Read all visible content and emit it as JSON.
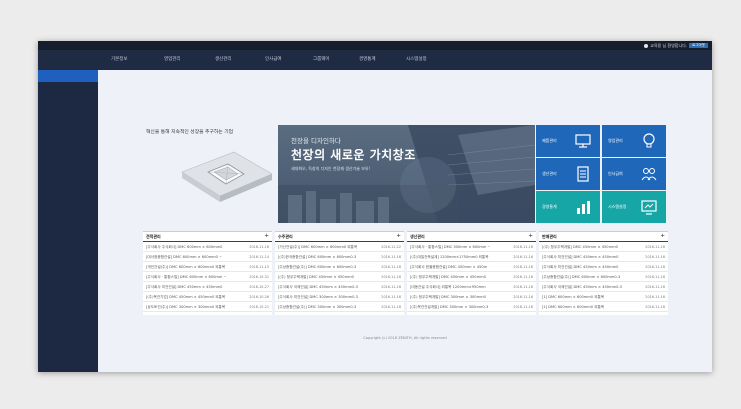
{
  "header": {
    "user_text": "교육용 님 환영합니다.",
    "logout_label": "로그아웃"
  },
  "nav": {
    "items": [
      "기본정보",
      "영업관리",
      "생산관리",
      "인사급여",
      "그룹웨어",
      "경영통계",
      "시스템설정"
    ]
  },
  "hero": {
    "slogan": "혁신을 통해 지속적인 성장을 추구하는 기업"
  },
  "banner": {
    "subtitle": "천장을 디자인하다",
    "title": "천장의 새로운 가치창조",
    "description": "세대화오, 독창의 디자인 천장재 생산기술 보유!"
  },
  "tiles": [
    {
      "label": "제품관리",
      "icon": "monitor-icon",
      "color": "#1f67b8"
    },
    {
      "label": "영업관리",
      "icon": "bulb-icon",
      "color": "#1f67b8"
    },
    {
      "label": "생산관리",
      "icon": "document-icon",
      "color": "#1f67b8"
    },
    {
      "label": "인사급여",
      "icon": "people-icon",
      "color": "#1f67b8"
    },
    {
      "label": "경영통계",
      "icon": "chart-icon",
      "color": "#17a6a6"
    },
    {
      "label": "시스템설정",
      "icon": "display-icon",
      "color": "#17a6a6"
    }
  ],
  "panels": [
    {
      "title": "견적관리",
      "rows": [
        {
          "text": "[주식회사 주식회사] DMC 600mm × 600mm0",
          "date": "2016-11-16"
        },
        {
          "text": "[대서정종합건설] DMC 600mm × 600mm0 ~",
          "date": "2016-11-14"
        },
        {
          "text": "[개인건설(주)] DMC 600mm × 600mm0 외통목",
          "date": "2016-11-15"
        },
        {
          "text": "[주식회사 · 통합스틸] DMC 600mm × 600mm ~",
          "date": "2016-10-31"
        },
        {
          "text": "[주식회사 미건건설] DMC 450mm × 450mm0",
          "date": "2016-10-27"
        },
        {
          "text": "[(주)목건기업] DMC 450mm × 450mm0 외통목",
          "date": "2016-10-26"
        },
        {
          "text": "[상도토건(주)] DMC 300mm × 300mm0 외통목",
          "date": "2016-10-21"
        }
      ]
    },
    {
      "title": "수주관리",
      "rows": [
        {
          "text": "[거산건설(주)] DMC 600mm × 600mm0 외통목",
          "date": "2016-11-22"
        },
        {
          "text": "[(주)한국종합건설] DMC 600mm × 600mm0-3",
          "date": "2016-11-16"
        },
        {
          "text": "[주상종합건설(주)] DMC 600mm × 600mm0-3",
          "date": "2016-11-16"
        },
        {
          "text": "[(주) 청우주택개발] DMC 450mm × 450mm0",
          "date": "2016-11-16"
        },
        {
          "text": "[주식회사 국제건설] DMC 450mm × 450mm0-3",
          "date": "2016-11-16"
        },
        {
          "text": "[주식회사 미건건설] DMC 300mm × 300mm0-3",
          "date": "2016-11-16"
        },
        {
          "text": "[주상종합건설(주)] DMC 300mm × 300mm0-3",
          "date": "2016-11-16"
        }
      ]
    },
    {
      "title": "생산관리",
      "rows": [
        {
          "text": "[주식회사 · 통합스틸] DMC 300mm × 600mm ~",
          "date": "2016-11-16"
        },
        {
          "text": "[(주)대일건축설계] 1200mm×1750mm0 외통목",
          "date": "2016-11-16"
        },
        {
          "text": "[주식회사 한울종합건설] DMC 450mm × 450m",
          "date": "2016-11-16"
        },
        {
          "text": "[(주) 청우주택개발] DMC 450mm × 450mm0",
          "date": "2016-11-16"
        },
        {
          "text": "[대동건설 주식회사] 외통목 1200mm×950mm",
          "date": "2016-11-16"
        },
        {
          "text": "[(주) 청우주택개발] DMC 300mm × 300mm0",
          "date": "2016-11-16"
        },
        {
          "text": "[(주)목건건설개발] DMC 300mm × 300mm0-3",
          "date": "2016-11-16"
        }
      ]
    },
    {
      "title": "판매관리",
      "rows": [
        {
          "text": "[(주) 청우주택개발] DMC 450mm × 450mm0",
          "date": "2016-11-16"
        },
        {
          "text": "[주식회사 미건건설] DMC 450mm × 450mm0",
          "date": "2016-11-16"
        },
        {
          "text": "[주식회사 미건건설] DMC 450mm × 450mm0",
          "date": "2016-11-16"
        },
        {
          "text": "[주상종합건설(주)] DMC 600mm × 600mm0-3",
          "date": "2016-11-16"
        },
        {
          "text": "[주식회사 국제건설] DMC 450mm × 450mm0-3",
          "date": "2016-11-16"
        },
        {
          "text": "[1] DMC 600mm × 600mm0 외통목",
          "date": "2016-11-16"
        },
        {
          "text": "[1] DMC 600mm × 600mm0 외통목",
          "date": "2016-11-16"
        }
      ]
    }
  ],
  "footer": {
    "copyright": "Copyright (c) 2016 ZENITH, All rights reserved"
  }
}
